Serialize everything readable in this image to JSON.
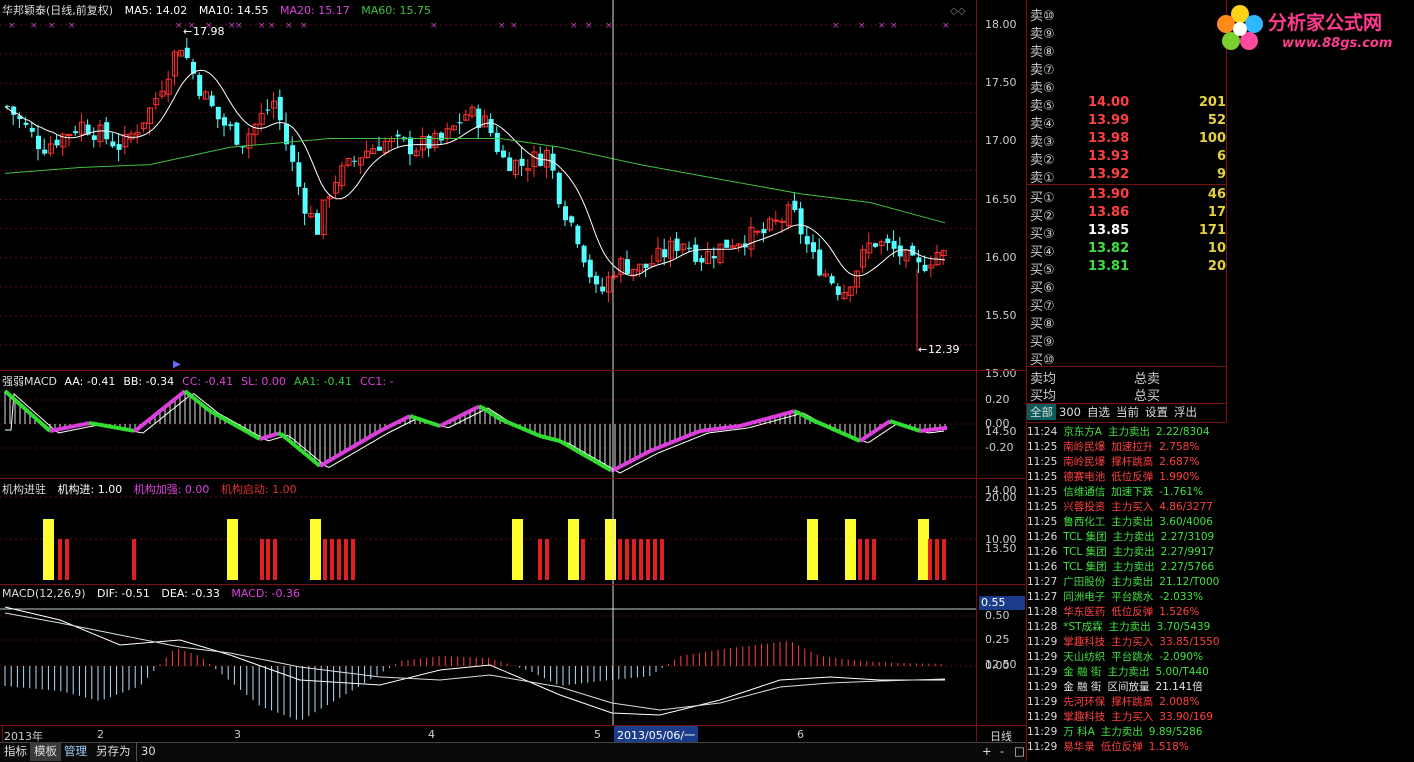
{
  "main": {
    "title": "华邦颖泰(日线,前复权)",
    "ma_labels": [
      "MA5: 14.02",
      "MA10: 14.55",
      "MA20: 15.17",
      "MA60: 15.75"
    ],
    "ma_colors": [
      "#ffffff",
      "#ffffff",
      "#e040e0",
      "#40c040"
    ],
    "high_label": "17.98",
    "low_label": "12.39",
    "axis": [
      "18.00",
      "17.50",
      "17.00",
      "16.50",
      "16.00",
      "15.50",
      "15.00",
      "14.50",
      "14.00",
      "13.50",
      "13.00",
      "12.50"
    ]
  },
  "macd_strong": {
    "title": "强弱MACD",
    "labels": [
      "AA: -0.41",
      "BB: -0.34",
      "CC: -0.41",
      "SL: 0.00",
      "AA1: -0.41",
      "CC1: -"
    ],
    "colors": [
      "#ffffff",
      "#ffffff",
      "#e040e0",
      "#e040e0",
      "#40c040",
      "#e040e0"
    ],
    "axis": [
      "0.20",
      "0.00",
      "-0.20"
    ]
  },
  "inst": {
    "title": "机构进驻",
    "labels": [
      "机构进: 1.00",
      "机构加强: 0.00",
      "机构启动: 1.00"
    ],
    "colors": [
      "#ffffff",
      "#e040e0",
      "#e03030"
    ],
    "axis": [
      "20.00",
      "10.00"
    ]
  },
  "macd": {
    "title": "MACD(12,26,9)",
    "labels": [
      "DIF: -0.51",
      "DEA: -0.33",
      "MACD: -0.36"
    ],
    "colors": [
      "#ffffff",
      "#ffffff",
      "#e040e0"
    ],
    "axis": [
      "0.50",
      "0.25",
      "0.00"
    ],
    "marker": "0.55"
  },
  "time_axis": {
    "labels": [
      "2013年",
      "2",
      "3",
      "4",
      "5",
      "6"
    ],
    "cursor_date": "2013/05/06/一",
    "period": "日线"
  },
  "bottom_tabs": [
    "指标",
    "模板",
    "管理",
    "另存为",
    "30"
  ],
  "zoom_buttons": [
    "+",
    "-",
    "□"
  ],
  "logo": {
    "text": "分析家公式网",
    "url": "www.88gs.com"
  },
  "order_book": {
    "sell_empty": [
      "卖⑩",
      "卖⑨",
      "卖⑧",
      "卖⑦",
      "卖⑥"
    ],
    "sells": [
      {
        "name": "卖⑤",
        "price": "14.00",
        "vol": "201",
        "color": "#ff4040"
      },
      {
        "name": "卖④",
        "price": "13.99",
        "vol": "52",
        "color": "#ff4040"
      },
      {
        "name": "卖③",
        "price": "13.98",
        "vol": "100",
        "color": "#ff4040"
      },
      {
        "name": "卖②",
        "price": "13.93",
        "vol": "6",
        "color": "#ff4040"
      },
      {
        "name": "卖①",
        "price": "13.92",
        "vol": "9",
        "color": "#ff4040"
      }
    ],
    "buys": [
      {
        "name": "买①",
        "price": "13.90",
        "vol": "46",
        "color": "#ff4040"
      },
      {
        "name": "买②",
        "price": "13.86",
        "vol": "17",
        "color": "#ff4040"
      },
      {
        "name": "买③",
        "price": "13.85",
        "vol": "171",
        "color": "#ffffff"
      },
      {
        "name": "买④",
        "price": "13.82",
        "vol": "10",
        "color": "#40e040"
      },
      {
        "name": "买⑤",
        "price": "13.81",
        "vol": "20",
        "color": "#40e040"
      }
    ],
    "buy_empty": [
      "买⑥",
      "买⑦",
      "买⑧",
      "买⑨",
      "买⑩"
    ],
    "avg_sell": "卖均",
    "total_sell": "总卖",
    "avg_buy": "买均",
    "total_buy": "总买"
  },
  "tape_tabs": [
    "全部",
    "300",
    "自选",
    "当前",
    "设置",
    "浮出"
  ],
  "tape": [
    {
      "t": "11:24",
      "n": "京东方A",
      "e": "主力卖出",
      "v": "2.22/8304",
      "c": "#40e040"
    },
    {
      "t": "11:25",
      "n": "南岭民爆",
      "e": "加速拉升",
      "v": "2.758%",
      "c": "#ff4040"
    },
    {
      "t": "11:25",
      "n": "南岭民爆",
      "e": "撑杆跳高",
      "v": "2.687%",
      "c": "#ff4040"
    },
    {
      "t": "11:25",
      "n": "德赛电池",
      "e": "低位反弹",
      "v": "1.990%",
      "c": "#ff4040"
    },
    {
      "t": "11:25",
      "n": "信维通信",
      "e": "加速下跌",
      "v": "-1.761%",
      "c": "#40e040"
    },
    {
      "t": "11:25",
      "n": "兴蓉投资",
      "e": "主力买入",
      "v": "4.86/3277",
      "c": "#ff4040"
    },
    {
      "t": "11:25",
      "n": "鲁西化工",
      "e": "主力卖出",
      "v": "3.60/4006",
      "c": "#40e040"
    },
    {
      "t": "11:26",
      "n": "TCL 集团",
      "e": "主力卖出",
      "v": "2.27/3109",
      "c": "#40e040"
    },
    {
      "t": "11:26",
      "n": "TCL 集团",
      "e": "主力卖出",
      "v": "2.27/9917",
      "c": "#40e040"
    },
    {
      "t": "11:26",
      "n": "TCL 集团",
      "e": "主力卖出",
      "v": "2.27/5766",
      "c": "#40e040"
    },
    {
      "t": "11:27",
      "n": "广田股份",
      "e": "主力卖出",
      "v": "21.12/T000",
      "c": "#40e040"
    },
    {
      "t": "11:27",
      "n": "同洲电子",
      "e": "平台跳水",
      "v": "-2.033%",
      "c": "#40e040"
    },
    {
      "t": "11:28",
      "n": "华东医药",
      "e": "低位反弹",
      "v": "1.526%",
      "c": "#ff4040"
    },
    {
      "t": "11:28",
      "n": "*ST成霖",
      "e": "主力卖出",
      "v": "3.70/5439",
      "c": "#40e040"
    },
    {
      "t": "11:29",
      "n": "掌趣科技",
      "e": "主力买入",
      "v": "33.85/1550",
      "c": "#ff4040"
    },
    {
      "t": "11:29",
      "n": "天山纺织",
      "e": "平台跳水",
      "v": "-2.090%",
      "c": "#40e040"
    },
    {
      "t": "11:29",
      "n": "金 融 街",
      "e": "主力卖出",
      "v": "5.00/T440",
      "c": "#40e040"
    },
    {
      "t": "11:29",
      "n": "金 融 街",
      "e": "区间放量",
      "v": "21.141倍",
      "c": "#e6e6e6"
    },
    {
      "t": "11:29",
      "n": "先河环保",
      "e": "撑杆跳高",
      "v": "2.008%",
      "c": "#ff4040"
    },
    {
      "t": "11:29",
      "n": "掌趣科技",
      "e": "主力买入",
      "v": "33.90/169",
      "c": "#ff4040"
    },
    {
      "t": "11:29",
      "n": "万 科A",
      "e": "主力卖出",
      "v": "9.89/5286",
      "c": "#40e040"
    },
    {
      "t": "11:29",
      "n": "易华录",
      "e": "低位反弹",
      "v": "1.518%",
      "c": "#ff4040"
    }
  ]
}
